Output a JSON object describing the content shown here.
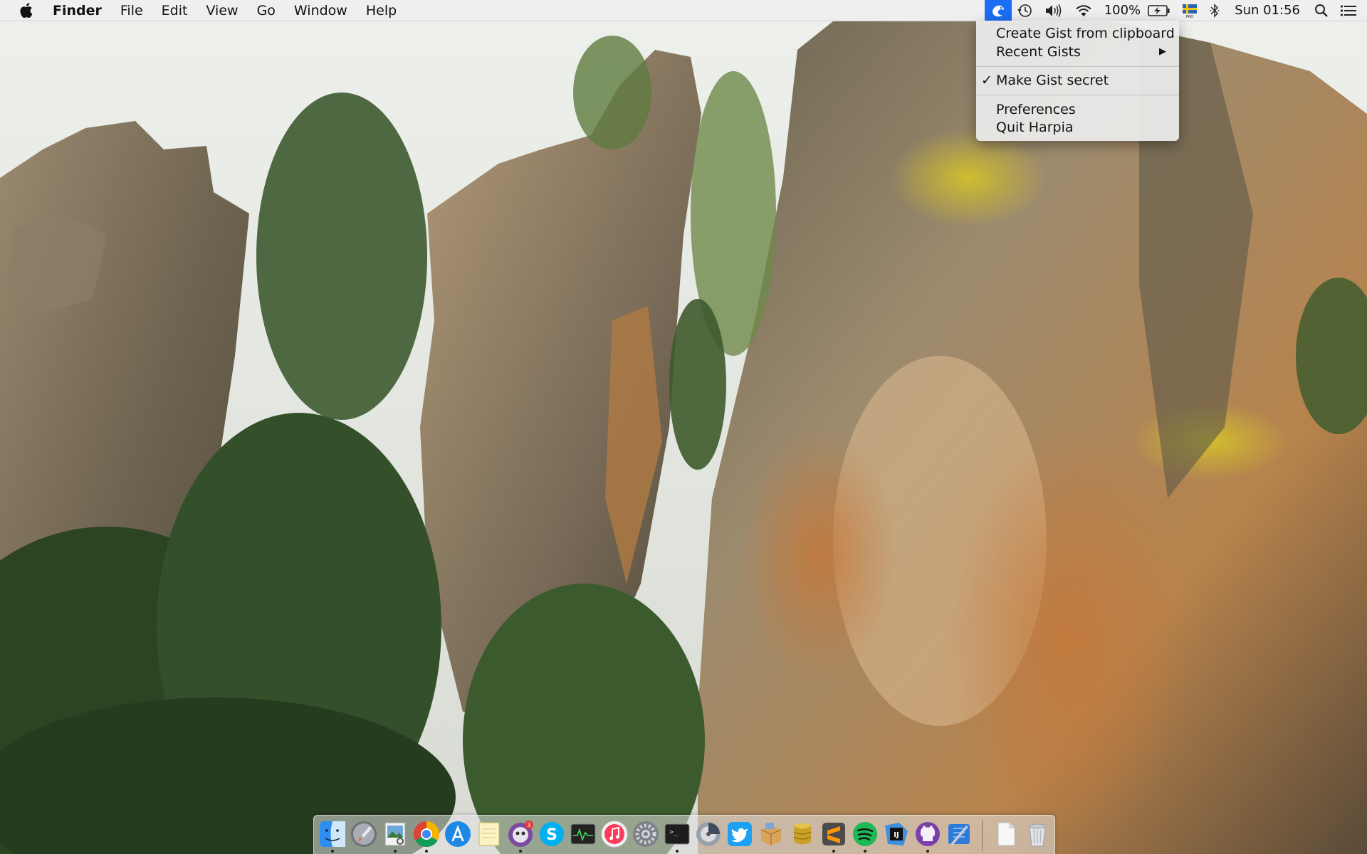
{
  "menubar": {
    "app_name": "Finder",
    "menus": [
      "File",
      "Edit",
      "View",
      "Go",
      "Window",
      "Help"
    ],
    "battery_percent": "100%",
    "clock": "Sun 01:56",
    "status_icons": [
      "harpia-gist-icon",
      "time-machine-icon",
      "volume-icon",
      "wifi-icon",
      "battery-charging-icon",
      "swedish-flag-input-icon",
      "bluetooth-icon",
      "spotlight-search-icon",
      "notification-center-icon"
    ]
  },
  "dropdown": {
    "items": [
      {
        "label": "Create Gist from clipboard",
        "checked": false,
        "submenu": false
      },
      {
        "label": "Recent Gists",
        "checked": false,
        "submenu": true
      },
      {
        "label": "Make Gist secret",
        "checked": true,
        "submenu": false
      },
      {
        "label": "Preferences",
        "checked": false,
        "submenu": false
      },
      {
        "label": "Quit Harpia",
        "checked": false,
        "submenu": false
      }
    ],
    "check_glyph": "✓",
    "submenu_glyph": "▶"
  },
  "dock": {
    "apps": [
      {
        "name": "finder-icon",
        "running": true
      },
      {
        "name": "launchpad-icon",
        "running": false
      },
      {
        "name": "preview-icon",
        "running": true
      },
      {
        "name": "chrome-icon",
        "running": true
      },
      {
        "name": "app-store-icon",
        "running": false
      },
      {
        "name": "notes-icon",
        "running": false
      },
      {
        "name": "tweetbot-icon",
        "running": true,
        "badge": "3"
      },
      {
        "name": "skype-icon",
        "running": false
      },
      {
        "name": "activity-monitor-icon",
        "running": false
      },
      {
        "name": "itunes-icon",
        "running": false
      },
      {
        "name": "system-preferences-icon",
        "running": false
      },
      {
        "name": "terminal-icon",
        "running": true
      },
      {
        "name": "disk-utility-icon",
        "running": false
      },
      {
        "name": "twitter-icon",
        "running": false
      },
      {
        "name": "archive-icon",
        "running": false
      },
      {
        "name": "database-icon",
        "running": false
      },
      {
        "name": "sublime-text-icon",
        "running": true
      },
      {
        "name": "spotify-icon",
        "running": true
      },
      {
        "name": "intellij-icon",
        "running": false
      },
      {
        "name": "github-icon",
        "running": true
      },
      {
        "name": "xcode-icon",
        "running": false
      },
      {
        "name": "documents-folder-icon",
        "running": false
      },
      {
        "name": "trash-icon",
        "running": false
      }
    ]
  },
  "colors": {
    "menubar_bg": "#eeeeee",
    "active_status_item": "#1b6ef3",
    "wallpaper_sky": "#e6e7e2",
    "rock_tan": "#a48b6a",
    "rock_orange": "#b8743a",
    "lichen_yellow": "#c9b72a",
    "foliage_green": "#2f4a26"
  }
}
